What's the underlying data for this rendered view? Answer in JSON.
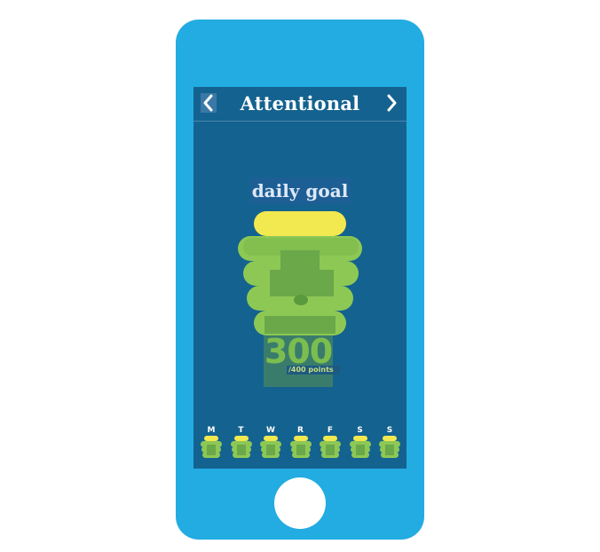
{
  "app": {
    "title": "Attentional",
    "prev_icon": "chevron-left-icon",
    "next_icon": "chevron-right-icon"
  },
  "goal": {
    "label": "daily goal",
    "points": "300",
    "points_sub": "/400 points",
    "progress_fraction": 0.75
  },
  "week": {
    "days": [
      "M",
      "T",
      "W",
      "R",
      "F",
      "S",
      "S"
    ]
  },
  "colors": {
    "phone": "#22ace2",
    "screen": "#14628f",
    "highlight": "#f2e84f",
    "green": "#8dc855",
    "green_dark": "#6faa40"
  }
}
